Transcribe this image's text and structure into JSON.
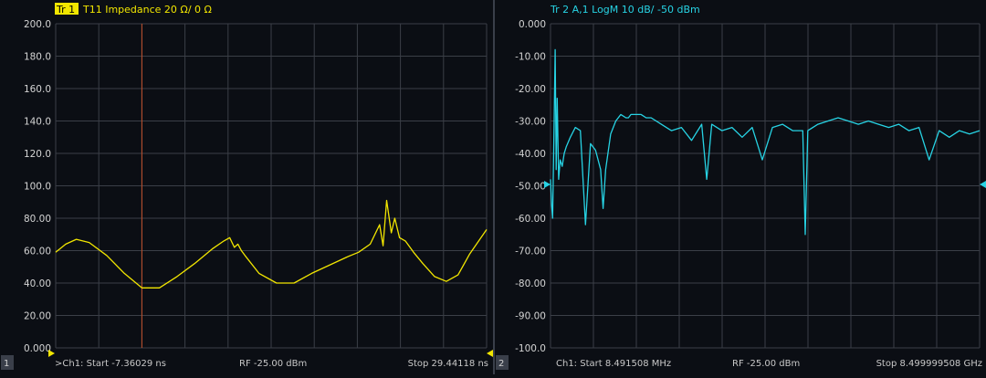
{
  "left": {
    "channel_index": "1",
    "trace_badge": "Tr 1",
    "trace_title": "T11  Impedance  20 Ω/  0 Ω",
    "footer": {
      "start": ">Ch1: Start -7.36029 ns",
      "rf": "RF -25.00 dBm",
      "stop": "Stop 29.44118 ns"
    }
  },
  "right": {
    "channel_index": "2",
    "trace_title": "Tr 2    A,1  LogM  10 dB/  -50 dBm",
    "footer": {
      "start": "Ch1: Start 8.491508 MHz",
      "rf": "RF -25.00 dBm",
      "stop": "Stop 8.499999508 GHz"
    }
  },
  "colors": {
    "trace1": "#f2e600",
    "trace2": "#27d3e4",
    "grid": "#3b3f47",
    "marker_line": "#c0502a",
    "ticks": "#d4d4d4"
  },
  "chart_data": [
    {
      "type": "line",
      "ylim": [
        0,
        200
      ],
      "xlim": [
        -7.36029,
        29.44118
      ],
      "yticks": [
        "200.0",
        "180.0",
        "160.0",
        "140.0",
        "120.0",
        "100.0",
        "80.00",
        "60.00",
        "40.00",
        "20.00",
        "0.000"
      ],
      "x_divisions": 10,
      "marker_x": 0.0,
      "series": [
        {
          "x": [
            -7.36,
            -6.5,
            -5.6,
            -4.5,
            -3.0,
            -1.5,
            0.0,
            1.5,
            3.0,
            4.5,
            6.0,
            7.0,
            7.5,
            7.9,
            8.2,
            8.5,
            8.8,
            10.0,
            11.5,
            13.0,
            14.5,
            16.0,
            17.5,
            18.5,
            19.5,
            20.3,
            20.6,
            20.9,
            21.3,
            21.6,
            22.0,
            22.5,
            23.2,
            24.0,
            25.0,
            26.0,
            27.0,
            28.0,
            29.44
          ],
          "y": [
            59,
            64,
            67,
            65,
            57,
            46,
            37,
            37,
            44,
            52,
            61,
            66,
            68,
            62,
            64,
            60,
            57,
            46,
            40,
            40,
            46,
            51,
            56,
            59,
            64,
            76,
            63,
            91,
            71,
            80,
            68,
            66,
            59,
            52,
            44,
            41,
            45,
            58,
            73
          ]
        }
      ]
    },
    {
      "type": "line",
      "ylim": [
        -100,
        0
      ],
      "xlim": [
        0.008491508,
        8.499999508
      ],
      "yticks": [
        "0.000",
        "-10.00",
        "-20.00",
        "-30.00",
        "-40.00",
        "-50.00",
        "-60.00",
        "-70.00",
        "-80.00",
        "-90.00",
        "-100.0"
      ],
      "x_divisions": 10,
      "reference_level": -50,
      "series": [
        {
          "x": [
            0.0085,
            0.03,
            0.05,
            0.08,
            0.1,
            0.12,
            0.14,
            0.17,
            0.2,
            0.24,
            0.28,
            0.32,
            0.4,
            0.5,
            0.6,
            0.7,
            0.8,
            0.9,
            1.0,
            1.05,
            1.1,
            1.2,
            1.3,
            1.4,
            1.5,
            1.55,
            1.6,
            1.7,
            1.8,
            1.9,
            2.0,
            2.2,
            2.4,
            2.6,
            2.8,
            3.0,
            3.1,
            3.2,
            3.4,
            3.6,
            3.8,
            4.0,
            4.2,
            4.4,
            4.6,
            4.8,
            5.0,
            5.05,
            5.1,
            5.3,
            5.5,
            5.7,
            5.9,
            6.1,
            6.3,
            6.5,
            6.7,
            6.9,
            7.1,
            7.3,
            7.5,
            7.7,
            7.9,
            8.1,
            8.3,
            8.5
          ],
          "y": [
            -48,
            -56,
            -60,
            -30,
            -8,
            -45,
            -23,
            -48,
            -42,
            -44,
            -40,
            -38,
            -35,
            -32,
            -33,
            -62,
            -37,
            -39,
            -45,
            -57,
            -45,
            -34,
            -30,
            -28,
            -29,
            -29,
            -28,
            -28,
            -28,
            -29,
            -29,
            -31,
            -33,
            -32,
            -36,
            -31,
            -48,
            -31,
            -33,
            -32,
            -35,
            -32,
            -42,
            -32,
            -31,
            -33,
            -33,
            -65,
            -33,
            -31,
            -30,
            -29,
            -30,
            -31,
            -30,
            -31,
            -32,
            -31,
            -33,
            -32,
            -42,
            -33,
            -35,
            -33,
            -34,
            -33
          ]
        }
      ]
    }
  ]
}
